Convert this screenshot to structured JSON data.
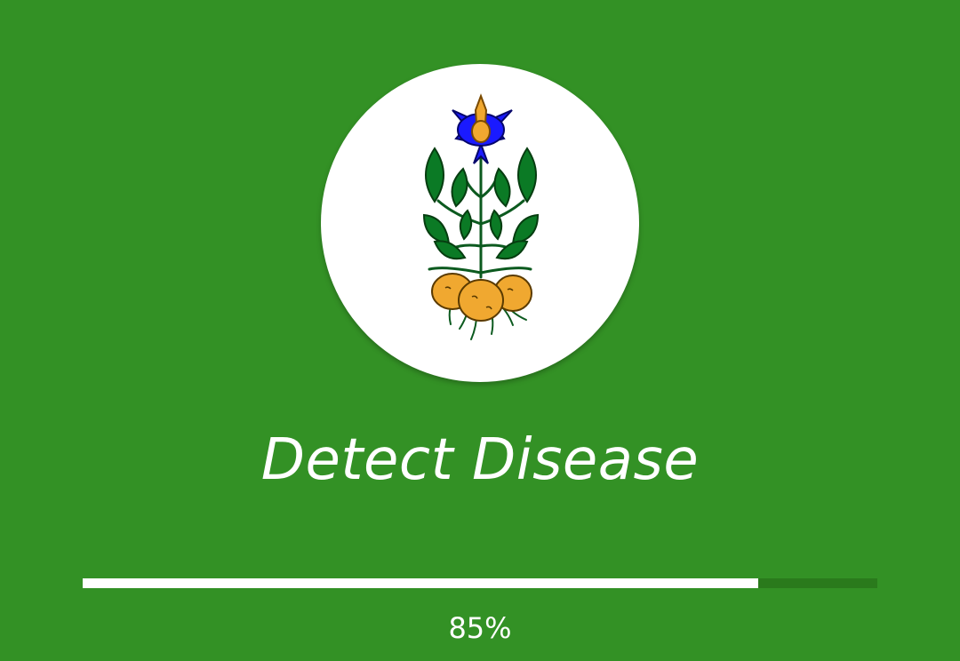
{
  "splash": {
    "title": "Detect Disease",
    "logo_icon": "potato-plant-icon",
    "background_color": "#339125"
  },
  "progress": {
    "value_percent": 85,
    "label": "85%",
    "fill_color": "#ffffff",
    "track_color": "#2a7a1c"
  }
}
